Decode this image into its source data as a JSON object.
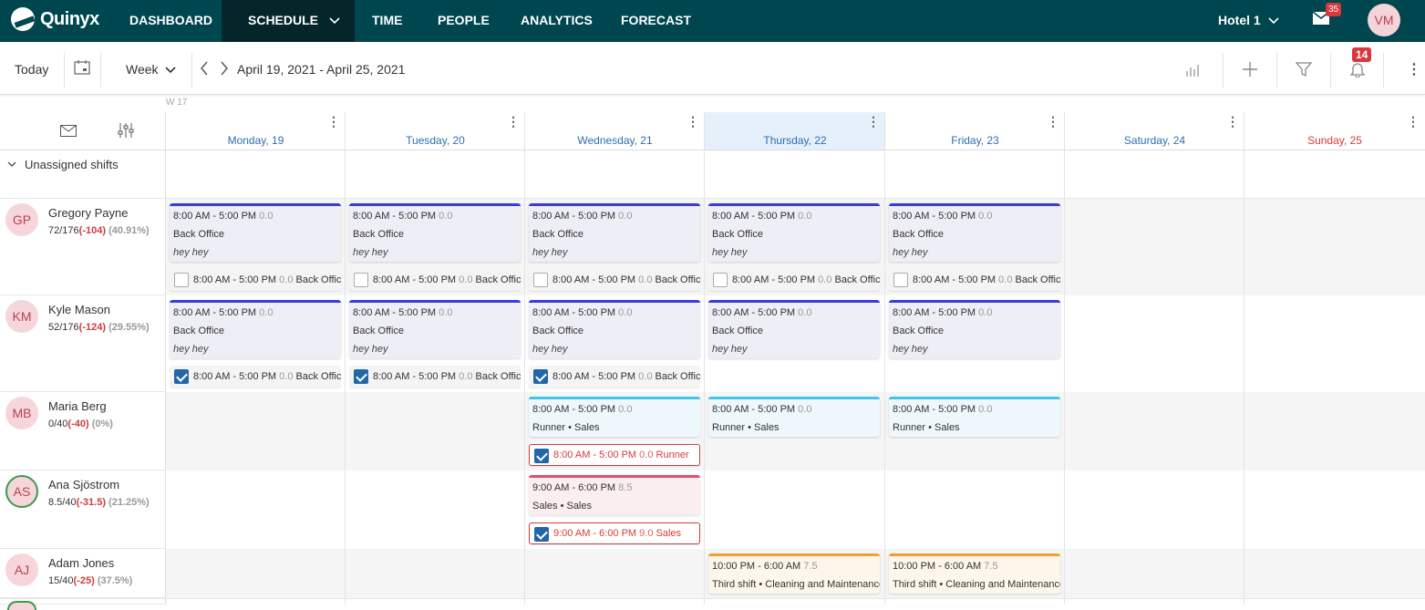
{
  "app": {
    "name": "Quinyx"
  },
  "nav": {
    "items": [
      "DASHBOARD",
      "SCHEDULE",
      "TIME",
      "PEOPLE",
      "ANALYTICS",
      "FORECAST"
    ],
    "active": "SCHEDULE",
    "unit": "Hotel 1",
    "mail_count": "35",
    "user_initials": "VM"
  },
  "toolbar": {
    "today": "Today",
    "view": "Week",
    "date_range": "April 19, 2021 - April 25, 2021",
    "notif_count": "14"
  },
  "week_label": "W 17",
  "days": [
    "Monday, 19",
    "Tuesday, 20",
    "Wednesday, 21",
    "Thursday, 22",
    "Friday, 23",
    "Saturday, 24",
    "Sunday, 25"
  ],
  "unassigned_label": "Unassigned shifts",
  "employees": [
    {
      "initials": "GP",
      "name": "Gregory Payne",
      "hours": "72/176",
      "diff": "(-104)",
      "pct": "(40.91%)"
    },
    {
      "initials": "KM",
      "name": "Kyle Mason",
      "hours": "52/176",
      "diff": "(-124)",
      "pct": "(29.55%)"
    },
    {
      "initials": "MB",
      "name": "Maria Berg",
      "hours": "0/40",
      "diff": "(-40)",
      "pct": "(0%)"
    },
    {
      "initials": "AS",
      "name": "Ana Sjöstrom",
      "hours": "8.5/40",
      "diff": "(-31.5)",
      "pct": "(21.25%)"
    },
    {
      "initials": "AJ",
      "name": "Adam Jones",
      "hours": "15/40",
      "diff": "(-25)",
      "pct": "(37.5%)"
    }
  ],
  "shift_texts": {
    "bo_time": "8:00 AM - 5:00 PM",
    "bo_hours": "0.0",
    "bo_name": "Back Office",
    "bo_note": "hey hey",
    "bo_task": "Back Office",
    "run_time": "8:00 AM - 5:00 PM",
    "run_hours": "0.0",
    "run_name": "Runner • Sales",
    "run_task": "Runner",
    "sales_time": "9:00 AM - 6:00 PM",
    "sales_hours": "8.5",
    "sales_name": "Sales • Sales",
    "sales_task_hours": "9.0",
    "sales_task": "Sales",
    "clean_time": "10:00 PM - 6:00 AM",
    "clean_hours": "7.5",
    "clean_name": "Third shift • Cleaning and Maintenance"
  },
  "colors": {
    "nav_bg": "#00464f",
    "nav_active": "#04252a",
    "backoffice": "#3b3bd9",
    "runner": "#3ec6ea",
    "sales": "#e34f6f",
    "cleaning": "#f0a030",
    "today_col": "#e6f0fa"
  }
}
